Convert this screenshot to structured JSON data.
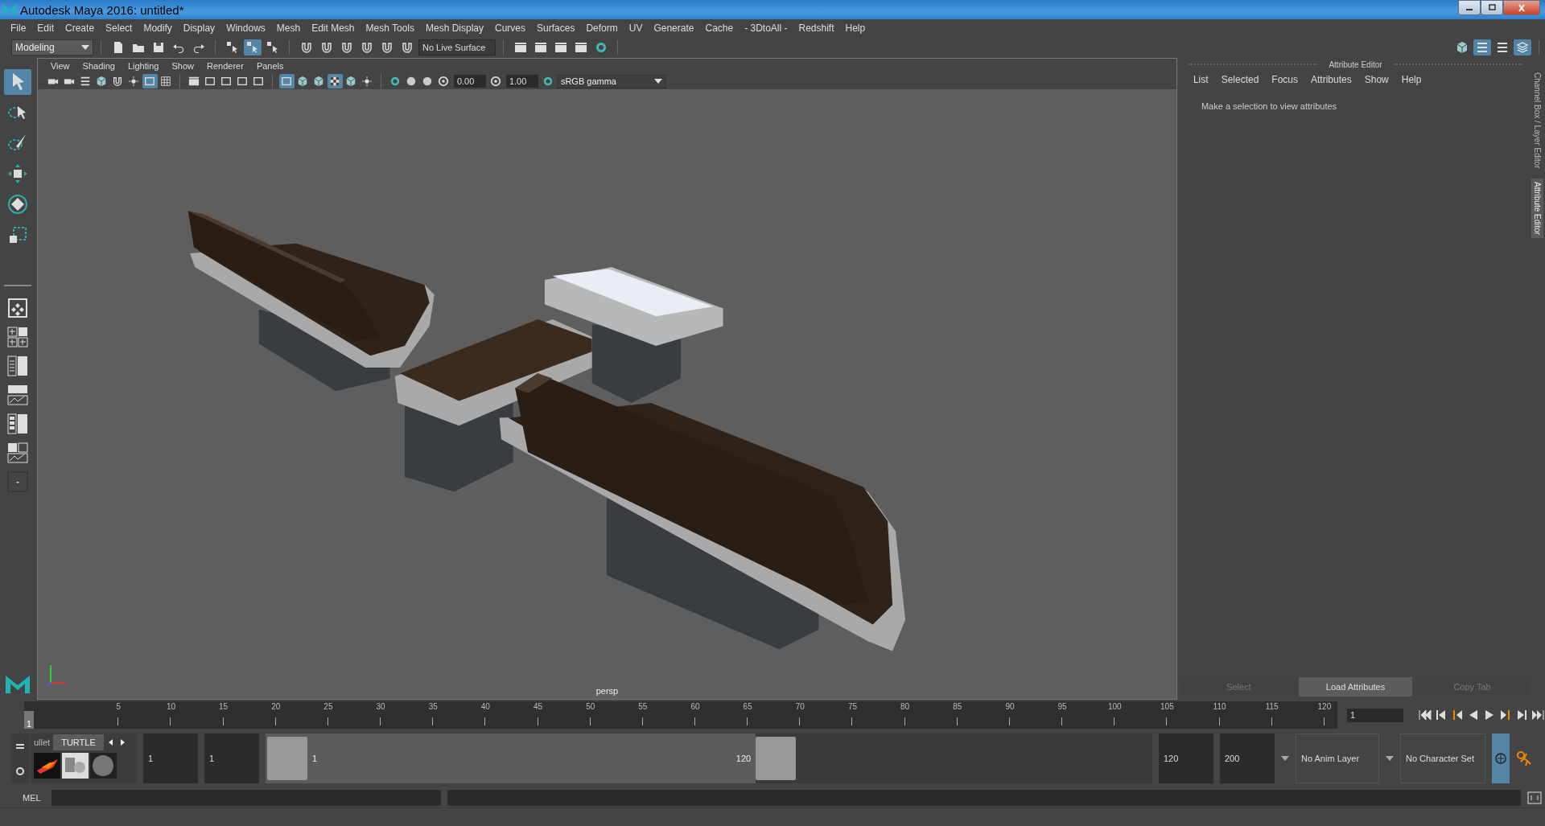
{
  "window": {
    "title": "Autodesk Maya 2016: untitled*"
  },
  "menu_bar": [
    "File",
    "Edit",
    "Create",
    "Select",
    "Modify",
    "Display",
    "Windows",
    "Mesh",
    "Edit Mesh",
    "Mesh Tools",
    "Mesh Display",
    "Curves",
    "Surfaces",
    "Deform",
    "UV",
    "Generate",
    "Cache",
    "- 3DtoAll -",
    "Redshift",
    "Help"
  ],
  "status_line": {
    "menu_set": "Modeling",
    "selection_modes": [
      {
        "on": false
      },
      {
        "on": true
      },
      {
        "on": false
      }
    ],
    "live_surface": "No Live Surface",
    "panel_toggles": [
      {
        "on": false
      },
      {
        "on": true
      },
      {
        "on": false
      },
      {
        "on": true
      }
    ]
  },
  "toolbox": {
    "tools": [
      {
        "kind": "select",
        "selected": true
      },
      {
        "kind": "lasso",
        "selected": false
      },
      {
        "kind": "paint",
        "selected": false
      },
      {
        "kind": "move",
        "selected": false
      },
      {
        "kind": "rotate",
        "selected": false
      },
      {
        "kind": "scale",
        "selected": false
      }
    ]
  },
  "viewport": {
    "menu": [
      "View",
      "Shading",
      "Lighting",
      "Show",
      "Renderer",
      "Panels"
    ],
    "toggles": [
      {
        "on": false
      },
      {
        "on": false
      },
      {
        "on": false
      },
      {
        "on": false
      },
      {
        "on": false
      },
      {
        "on": false
      },
      {
        "on": true
      },
      {
        "on": false
      },
      {
        "on": false
      },
      {
        "on": false
      },
      {
        "on": false
      },
      {
        "on": false
      },
      {
        "on": false
      },
      {
        "on": true
      },
      {
        "on": false
      },
      {
        "on": false
      },
      {
        "on": true
      },
      {
        "on": false
      },
      {
        "on": false
      },
      {
        "on": false
      },
      {
        "on": false
      },
      {
        "on": false
      }
    ],
    "exposure": "0.00",
    "gamma": "1.00",
    "color_space": "sRGB gamma",
    "camera": "persp"
  },
  "attribute_editor": {
    "title": "Attribute Editor",
    "menu": [
      "List",
      "Selected",
      "Focus",
      "Attributes",
      "Show",
      "Help"
    ],
    "message": "Make a selection to view attributes",
    "buttons": [
      {
        "label": "Select",
        "disabled": true
      },
      {
        "label": "Load Attributes",
        "disabled": false
      },
      {
        "label": "Copy Tab",
        "disabled": true
      }
    ]
  },
  "side_tabs": [
    {
      "label": "Channel Box / Layer Editor",
      "selected": false
    },
    {
      "label": "Attribute Editor",
      "selected": true
    }
  ],
  "time_slider": {
    "current": "1",
    "level": 0,
    "ticks": [
      "5",
      "10",
      "15",
      "20",
      "25",
      "30",
      "35",
      "40",
      "45",
      "50",
      "55",
      "60",
      "65",
      "70",
      "75",
      "80",
      "85",
      "90",
      "95",
      "100",
      "105",
      "110",
      "115",
      "120"
    ],
    "current_frame_field": "1"
  },
  "shelf": {
    "tabs": [
      {
        "label": "ullet",
        "selected": false
      },
      {
        "label": "TURTLE",
        "selected": true
      }
    ]
  },
  "range_slider": {
    "level": 0.6,
    "start": "1",
    "playback_start": "1",
    "range_start_label": "1",
    "range_end_label": "120",
    "playback_end": "120",
    "end": "200",
    "anim_layer": "No Anim Layer",
    "character_set": "No Character Set"
  },
  "command_line": {
    "label": "MEL"
  }
}
